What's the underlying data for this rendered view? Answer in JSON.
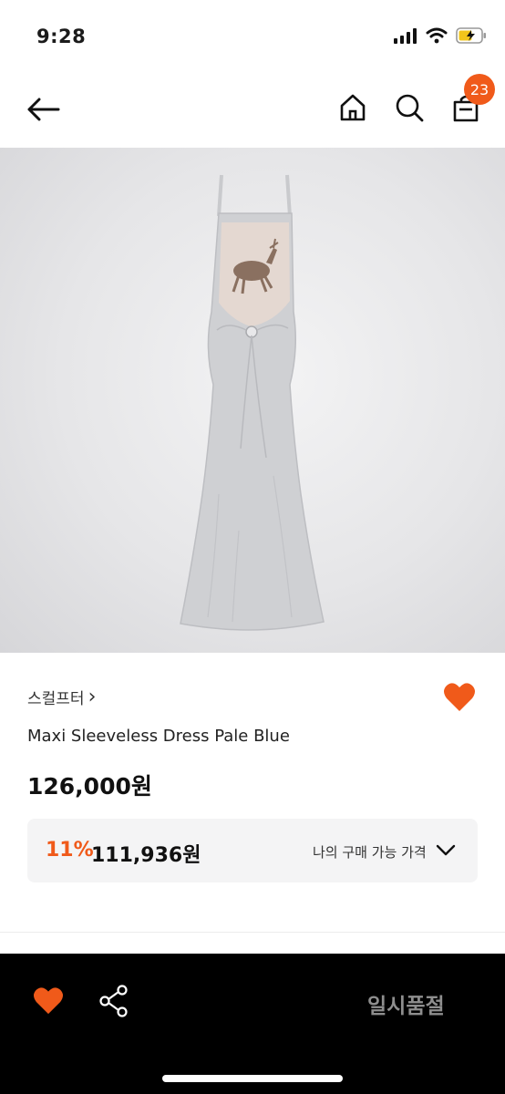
{
  "status_bar": {
    "time": "9:28"
  },
  "header": {
    "cart_count": "23"
  },
  "product": {
    "brand": "스컬프터",
    "brand_chevron": "›",
    "name": "Maxi Sleeveless Dress Pale Blue",
    "price": "126,000원",
    "image_alt": "Pale blue maxi sleeveless dress with deer print"
  },
  "discount": {
    "rate": "11%",
    "price": "111,936원",
    "label": "나의 구매 가능 가격"
  },
  "bottom_bar": {
    "soldout_label": "일시품절"
  },
  "colors": {
    "accent": "#f05a1a",
    "bottom_bar_bg": "#000000",
    "discount_box_bg": "#f4f4f5"
  },
  "icons": [
    "back-arrow-icon",
    "home-icon",
    "search-icon",
    "cart-icon",
    "heart-icon",
    "share-icon",
    "chevron-down-icon",
    "signal-icon",
    "wifi-icon",
    "battery-icon"
  ]
}
